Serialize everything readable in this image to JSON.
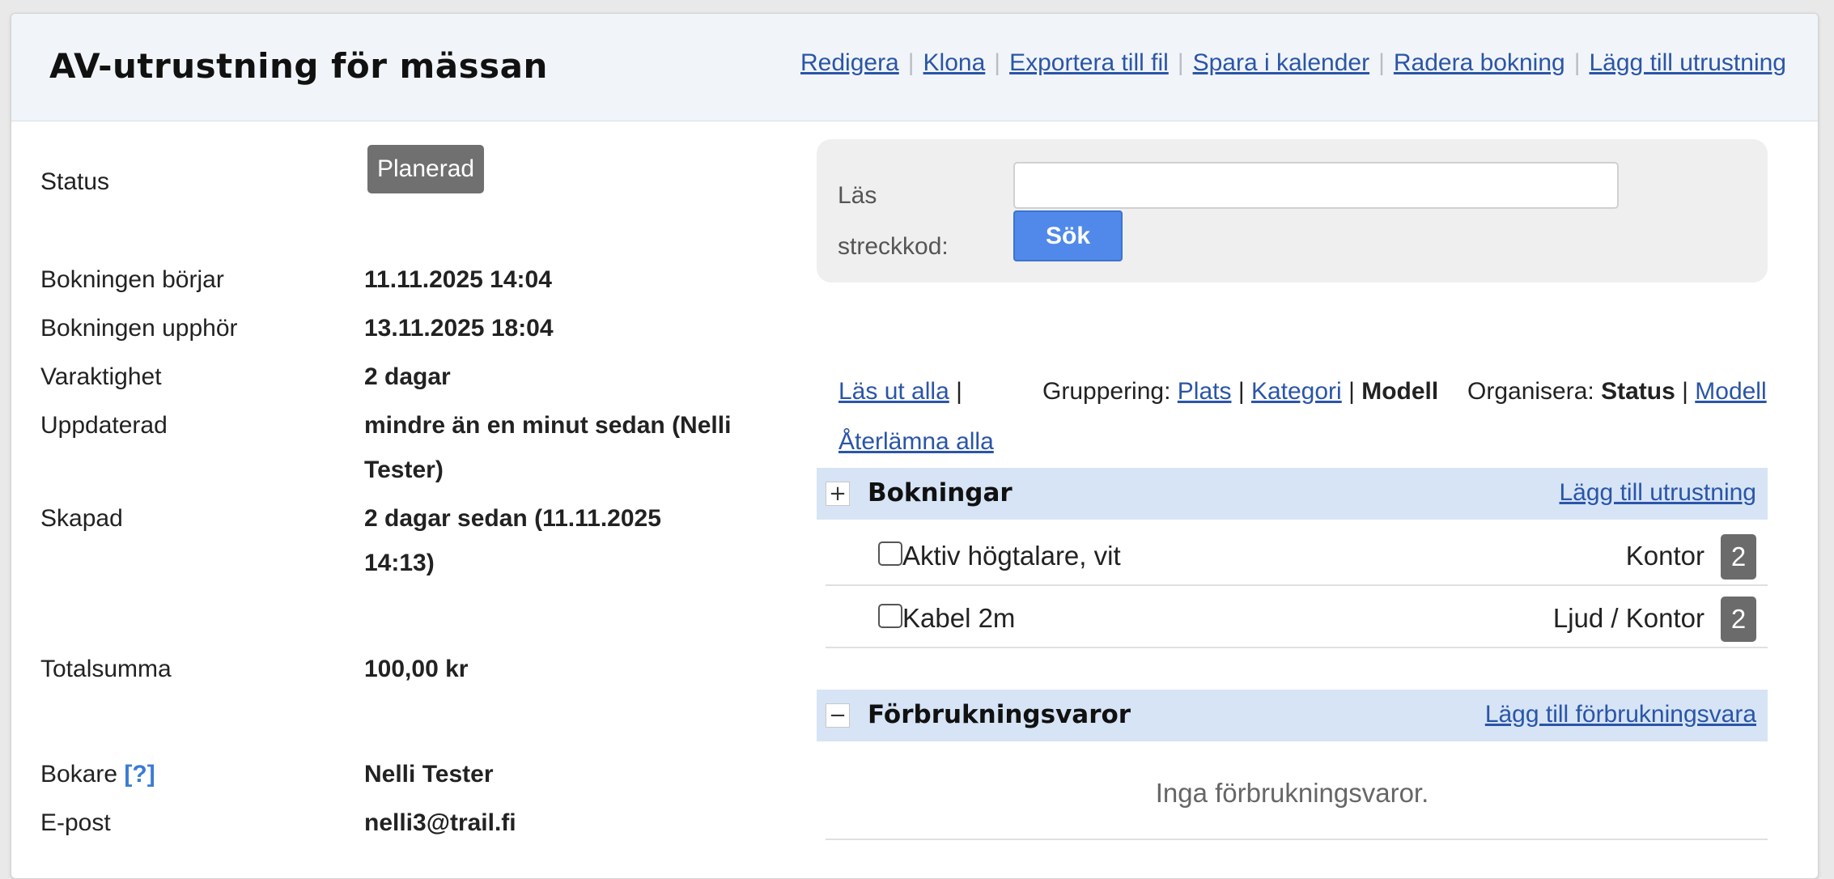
{
  "header": {
    "title": "AV-utrustning för mässan",
    "actions": [
      "Redigera",
      "Klona",
      "Exportera till fil",
      "Spara i kalender",
      "Radera bokning",
      "Lägg till utrustning"
    ]
  },
  "details": {
    "status_label": "Status",
    "status_value": "Planerad",
    "starts_label": "Bokningen börjar",
    "starts_value": "11.11.2025 14:04",
    "ends_label": "Bokningen upphör",
    "ends_value": "13.11.2025 18:04",
    "duration_label": "Varaktighet",
    "duration_value": "2 dagar",
    "updated_label": "Uppdaterad",
    "updated_value_1": "mindre än en minut sedan (Nelli",
    "updated_value_2": "Tester)",
    "created_label": "Skapad",
    "created_value_1": "2 dagar sedan (11.11.2025",
    "created_value_2": "14:13)",
    "total_label": "Totalsumma",
    "total_value": "100,00 kr",
    "booker_label": "Bokare",
    "booker_help": "[?]",
    "booker_value": "Nelli Tester",
    "email_label": "E-post",
    "email_value": "nelli3@trail.fi"
  },
  "scan": {
    "label_1": "Läs",
    "label_2": "streckkod:",
    "input_value": "",
    "button_label": "Sök"
  },
  "toolbar": {
    "checkout_all": "Läs ut alla",
    "return_all": "Återlämna alla",
    "pipe": "|",
    "grouping_label": "Gruppering:",
    "grouping_options": [
      "Plats",
      "Kategori",
      "Modell"
    ],
    "organize_label": "Organisera:",
    "organize_options": [
      "Status",
      "Modell"
    ]
  },
  "bookings": {
    "toggle": "+",
    "title": "Bokningar",
    "add_link": "Lägg till utrustning",
    "items": [
      {
        "name": "Aktiv högtalare, vit",
        "location": "Kontor",
        "qty": "2"
      },
      {
        "name": "Kabel 2m",
        "location": "Ljud / Kontor",
        "qty": "2"
      }
    ]
  },
  "consumables": {
    "toggle": "−",
    "title": "Förbrukningsvaror",
    "add_link": "Lägg till förbrukningsvara",
    "empty_text": "Inga förbrukningsvaror."
  }
}
